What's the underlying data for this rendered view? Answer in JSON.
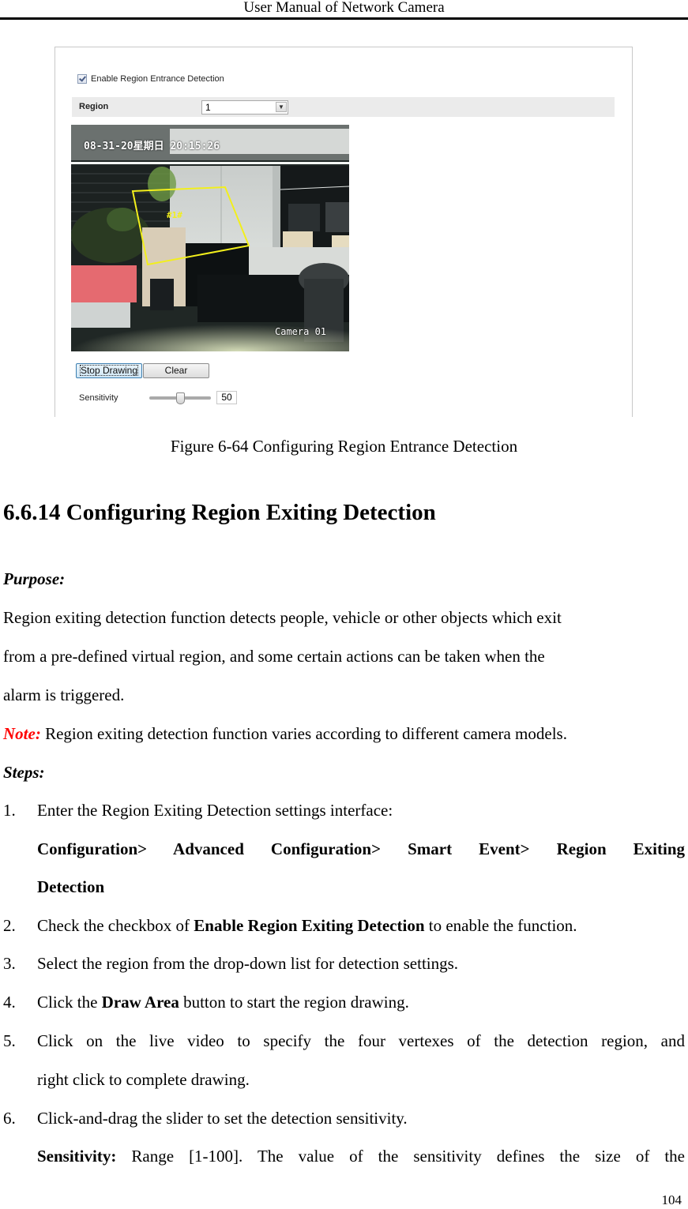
{
  "header": {
    "title": "User Manual of Network Camera"
  },
  "figure": {
    "enable_checkbox": {
      "label": "Enable Region Entrance Detection",
      "checked": true
    },
    "region": {
      "label": "Region",
      "selected": "1"
    },
    "video": {
      "osd_time": "08-31-20",
      "osd_date_suffix": "星期日 20:15:26",
      "camera_name": "Camera 01",
      "region_tag": "#1#"
    },
    "buttons": {
      "stop_drawing": "Stop Drawing",
      "clear": "Clear"
    },
    "sensitivity": {
      "label": "Sensitivity",
      "value": "50",
      "min": 1,
      "max": 100
    },
    "colors": {
      "region_outline": "#f2ef1c"
    }
  },
  "caption": "Figure 6-64 Configuring Region Entrance Detection",
  "section": {
    "title": "6.6.14 Configuring Region Exiting Detection"
  },
  "purpose": {
    "heading": "Purpose:",
    "lines": [
      "Region exiting detection function detects people, vehicle or other objects which exit",
      "from a pre-defined virtual region, and some certain actions can be taken when the",
      "alarm is triggered."
    ]
  },
  "note": {
    "label": "Note:",
    "text": " Region exiting detection function varies according to different camera models."
  },
  "steps": {
    "heading": "Steps:",
    "items": [
      {
        "num": "1.",
        "text": "Enter the Region Exiting Detection settings interface:"
      },
      {
        "num": "2.",
        "pre": "Check the checkbox of ",
        "bold": "Enable Region Exiting Detection",
        "post": " to enable the function."
      },
      {
        "num": "3.",
        "text": "Select the region from the drop-down list for detection settings."
      },
      {
        "num": "4.",
        "pre": "Click the ",
        "bold": "Draw Area",
        "post": " button to start the region drawing."
      },
      {
        "num": "5.",
        "line1": "Click on the live video to specify the four vertexes of the detection region, and",
        "line2": "right click to complete drawing."
      },
      {
        "num": "6.",
        "text": "Click-and-drag the slider to set the detection sensitivity."
      }
    ],
    "menu_path": {
      "line1": [
        "Configuration>",
        "Advanced",
        "Configuration>",
        "Smart",
        "Event>",
        "Region",
        "Exiting"
      ],
      "line2": "Detection"
    },
    "sensitivity_note": {
      "label": "Sensitivity:",
      "text": " Range [1-100]. The value of the sensitivity defines the size of the"
    }
  },
  "page_number": "104"
}
